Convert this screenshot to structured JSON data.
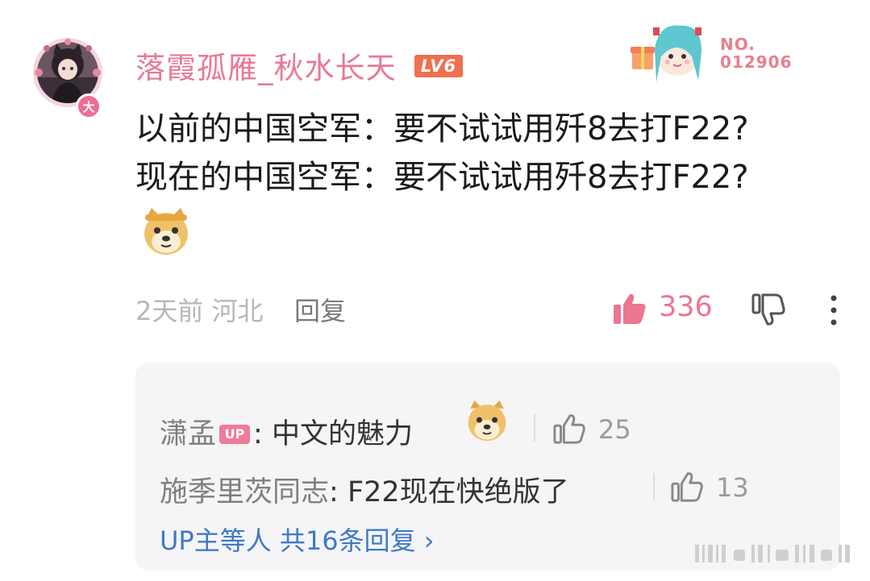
{
  "user": {
    "name": "落霞孤雁_秋水长天",
    "level": "LV6",
    "avatar_badge": "大",
    "decoration_no_label": "NO.",
    "decoration_no_value": "012906"
  },
  "comment": {
    "line1": "以前的中国空军：要不试试用歼8去打F22?",
    "line2": "现在的中国空军：要不试试用歼8去打F22?",
    "emoji": "doge-icon"
  },
  "meta": {
    "time_location": "2天前 河北",
    "reply_label": "回复",
    "like_count": "336"
  },
  "replies": {
    "items": [
      {
        "author": "潇孟",
        "badge": "UP",
        "separator": ":",
        "text": " 中文的魅力",
        "likes": "25"
      },
      {
        "author": "施季里茨同志",
        "separator": ":",
        "text": " F22现在快绝版了",
        "likes": "13"
      }
    ],
    "more_text": "UP主等人 共16条回复 ›"
  },
  "colors": {
    "username": "#e77a95",
    "level_badge": "#ef6f4f",
    "like_active": "#ec7592",
    "link": "#3f79c7",
    "reply_box_bg": "#f5f5f7"
  }
}
